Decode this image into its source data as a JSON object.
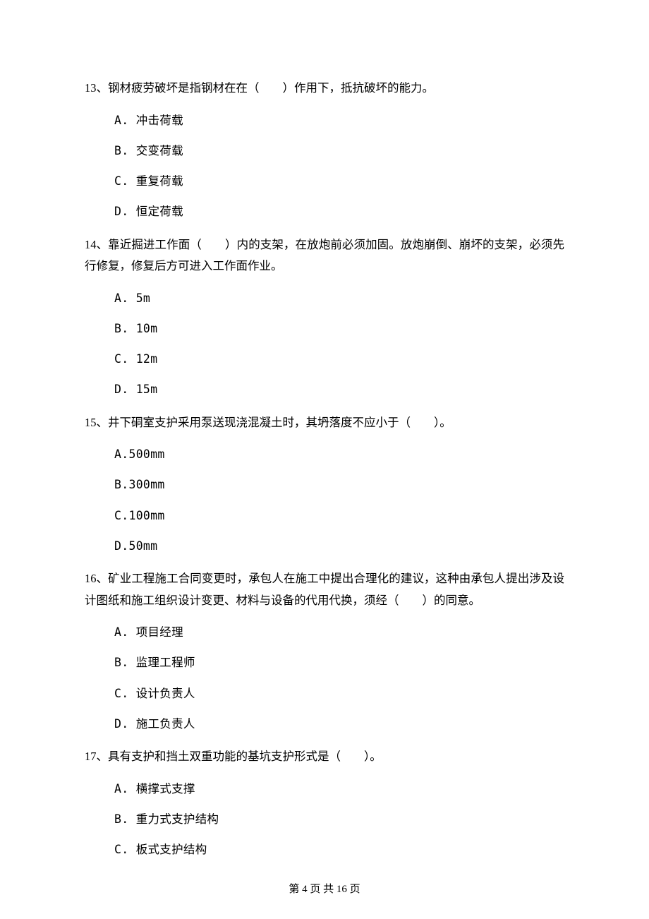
{
  "questions": [
    {
      "num": "13",
      "stem": "13、钢材疲劳破坏是指钢材在在（　　）作用下，抵抗破坏的能力。",
      "options": [
        "A. 冲击荷载",
        "B. 交变荷载",
        "C. 重复荷载",
        "D. 恒定荷载"
      ]
    },
    {
      "num": "14",
      "stem": "14、靠近掘进工作面（　　）内的支架，在放炮前必须加固。放炮崩倒、崩坏的支架，必须先行修复，修复后方可进入工作面作业。",
      "options": [
        "A. 5m",
        "B. 10m",
        "C. 12m",
        "D. 15m"
      ]
    },
    {
      "num": "15",
      "stem": "15、井下硐室支护采用泵送现浇混凝土时，其坍落度不应小于（　　）。",
      "options": [
        "A.500mm",
        "B.300mm",
        "C.100mm",
        "D.50mm"
      ]
    },
    {
      "num": "16",
      "stem": "16、矿业工程施工合同变更时，承包人在施工中提出合理化的建议，这种由承包人提出涉及设计图纸和施工组织设计变更、材料与设备的代用代换，须经（　　）的同意。",
      "options": [
        "A. 项目经理",
        "B. 监理工程师",
        "C. 设计负责人",
        "D. 施工负责人"
      ]
    },
    {
      "num": "17",
      "stem": "17、具有支护和挡土双重功能的基坑支护形式是（　　）。",
      "options": [
        "A. 横撑式支撑",
        "B. 重力式支护结构",
        "C. 板式支护结构"
      ]
    }
  ],
  "footer": "第 4 页 共 16 页"
}
